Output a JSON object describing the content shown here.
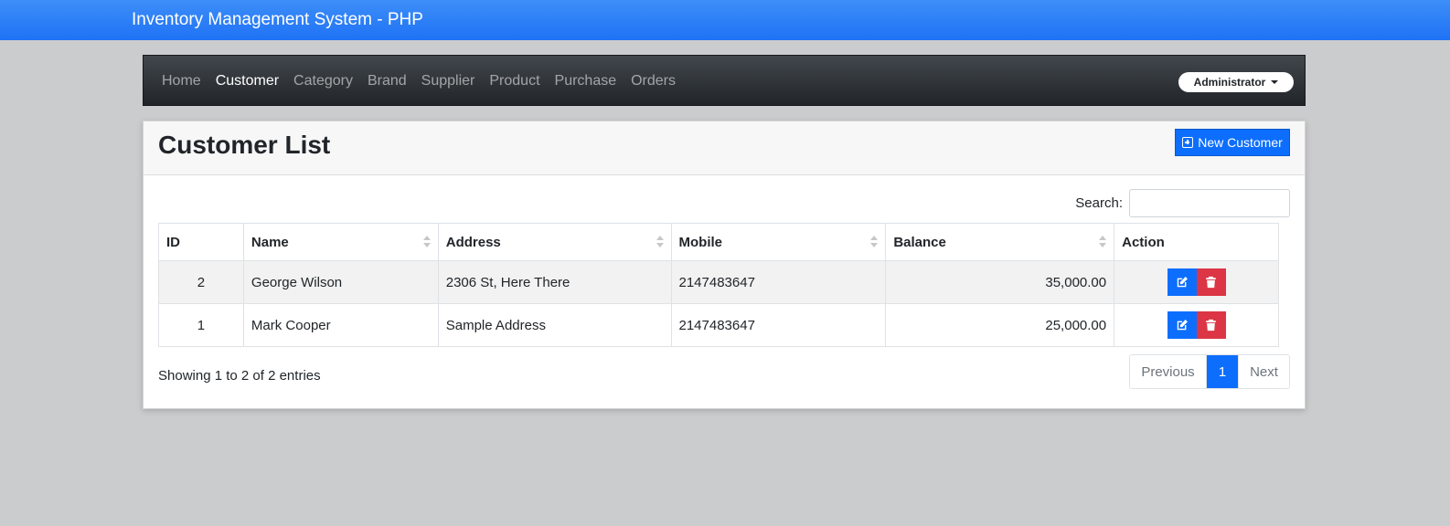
{
  "app": {
    "title": "Inventory Management System - PHP"
  },
  "nav": {
    "items": [
      {
        "label": "Home"
      },
      {
        "label": "Customer",
        "active": true
      },
      {
        "label": "Category"
      },
      {
        "label": "Brand"
      },
      {
        "label": "Supplier"
      },
      {
        "label": "Product"
      },
      {
        "label": "Purchase"
      },
      {
        "label": "Orders"
      }
    ],
    "user_menu": "Administrator"
  },
  "page": {
    "title": "Customer List",
    "new_button": "New Customer",
    "search_label": "Search:",
    "search_value": ""
  },
  "table": {
    "columns": [
      "ID",
      "Name",
      "Address",
      "Mobile",
      "Balance",
      "Action"
    ],
    "rows": [
      {
        "id": "2",
        "name": "George Wilson",
        "address": "2306 St, Here There",
        "mobile": "2147483647",
        "balance": "35,000.00"
      },
      {
        "id": "1",
        "name": "Mark Cooper",
        "address": "Sample Address",
        "mobile": "2147483647",
        "balance": "25,000.00"
      }
    ]
  },
  "footer": {
    "info": "Showing 1 to 2 of 2 entries",
    "pagination": {
      "previous": "Previous",
      "current": "1",
      "next": "Next"
    }
  },
  "colors": {
    "primary": "#0d6efd",
    "danger": "#dc3545",
    "navbar": "#212529",
    "topbar": "#2a7cf7"
  }
}
